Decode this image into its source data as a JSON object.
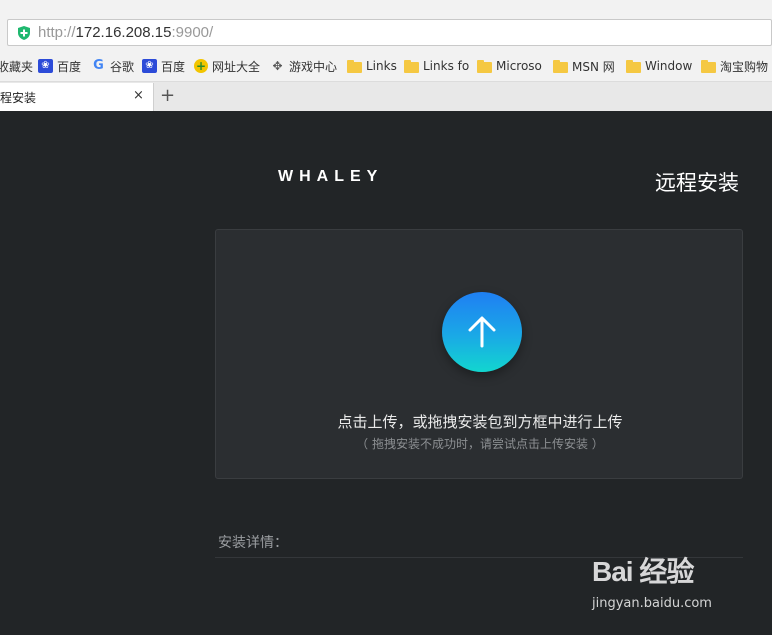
{
  "browser": {
    "url_scheme": "http://",
    "url_host": "172.16.208.15",
    "url_rest": ":9900/",
    "bookmarks": [
      {
        "label": "收藏夹",
        "icon": "folder-icon"
      },
      {
        "label": "百度",
        "icon": "baidu-paw-icon"
      },
      {
        "label": "谷歌",
        "icon": "google-icon"
      },
      {
        "label": "百度",
        "icon": "baidu-paw-icon"
      },
      {
        "label": "网址大全",
        "icon": "navigation-icon"
      },
      {
        "label": "游戏中心",
        "icon": "gamepad-icon"
      },
      {
        "label": "Links",
        "icon": "folder-icon"
      },
      {
        "label": "Links fo",
        "icon": "folder-icon"
      },
      {
        "label": "Microso",
        "icon": "folder-icon"
      },
      {
        "label": "MSN 网",
        "icon": "folder-icon"
      },
      {
        "label": "Window",
        "icon": "folder-icon"
      },
      {
        "label": "淘宝购物",
        "icon": "folder-icon"
      }
    ],
    "tab": {
      "title": "程安装",
      "close": "×"
    },
    "new_tab": "+"
  },
  "page": {
    "logo": "WHALEY",
    "title": "远程安装",
    "upload_main": "点击上传，或拖拽安装包到方框中进行上传",
    "upload_sub": "（ 拖拽安装不成功时，请尝试点击上传安装 ）",
    "details_label": "安装详情："
  },
  "watermark": {
    "brand": "Bai 经验",
    "url": "jingyan.baidu.com"
  },
  "colors": {
    "page_bg": "#222527",
    "box_bg": "#2b2e31",
    "accent_top": "#1f7ff3",
    "accent_bottom": "#12d6cf"
  }
}
